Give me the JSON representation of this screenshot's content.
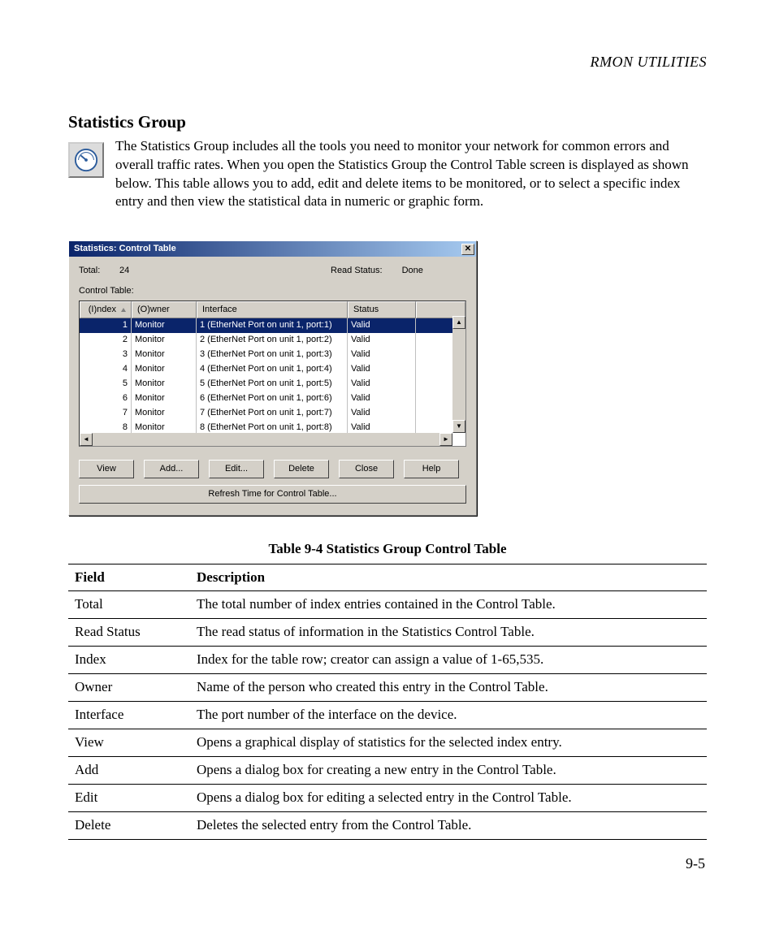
{
  "header": {
    "running": "RMON UTILITIES"
  },
  "section": {
    "title": "Statistics Group"
  },
  "intro": {
    "text": "The Statistics Group includes all the tools you need to monitor your network for common errors and overall traffic rates. When you open the Statistics Group the Control Table screen is displayed as shown below. This table allows you to add, edit and delete items to be monitored, or to select a specific index entry and then view the statistical data in numeric or graphic form."
  },
  "dialog": {
    "title": "Statistics: Control Table",
    "total_label": "Total:",
    "total_value": "24",
    "read_status_label": "Read Status:",
    "read_status_value": "Done",
    "control_table_label": "Control Table:",
    "headers": {
      "index": "(I)ndex",
      "owner": "(O)wner",
      "interface": "Interface",
      "status": "Status"
    },
    "rows": [
      {
        "index": "1",
        "owner": "Monitor",
        "iface": "1 (EtherNet Port on unit 1, port:1)",
        "status": "Valid",
        "selected": true
      },
      {
        "index": "2",
        "owner": "Monitor",
        "iface": "2 (EtherNet Port on unit 1, port:2)",
        "status": "Valid"
      },
      {
        "index": "3",
        "owner": "Monitor",
        "iface": "3 (EtherNet Port on unit 1, port:3)",
        "status": "Valid"
      },
      {
        "index": "4",
        "owner": "Monitor",
        "iface": "4 (EtherNet Port on unit 1, port:4)",
        "status": "Valid"
      },
      {
        "index": "5",
        "owner": "Monitor",
        "iface": "5 (EtherNet Port on unit 1, port:5)",
        "status": "Valid"
      },
      {
        "index": "6",
        "owner": "Monitor",
        "iface": "6 (EtherNet Port on unit 1, port:6)",
        "status": "Valid"
      },
      {
        "index": "7",
        "owner": "Monitor",
        "iface": "7 (EtherNet Port on unit 1, port:7)",
        "status": "Valid"
      },
      {
        "index": "8",
        "owner": "Monitor",
        "iface": "8 (EtherNet Port on unit 1, port:8)",
        "status": "Valid"
      }
    ],
    "buttons": {
      "view": "View",
      "add": "Add...",
      "edit": "Edit...",
      "delete": "Delete",
      "close": "Close",
      "help": "Help",
      "refresh": "Refresh Time for Control Table..."
    }
  },
  "table_caption": "Table 9-4  Statistics Group Control Table",
  "def_headers": {
    "field": "Field",
    "desc": "Description"
  },
  "defs": [
    {
      "field": "Total",
      "desc": "The total number of index entries contained in the Control Table."
    },
    {
      "field": "Read Status",
      "desc": "The read status of information in the Statistics Control Table."
    },
    {
      "field": "Index",
      "desc": "Index for the table row; creator can assign a value of 1-65,535."
    },
    {
      "field": "Owner",
      "desc": "Name of the person who created this entry in the Control Table."
    },
    {
      "field": "Interface",
      "desc": "The port number of the interface on the device."
    },
    {
      "field": "View",
      "desc": "Opens a graphical display of statistics for the selected index entry."
    },
    {
      "field": "Add",
      "desc": "Opens a dialog box for creating a new entry in the Control Table."
    },
    {
      "field": "Edit",
      "desc": "Opens a dialog box for editing a selected entry in the Control Table."
    },
    {
      "field": "Delete",
      "desc": "Deletes the selected entry from the Control Table."
    }
  ],
  "page_number": "9-5"
}
